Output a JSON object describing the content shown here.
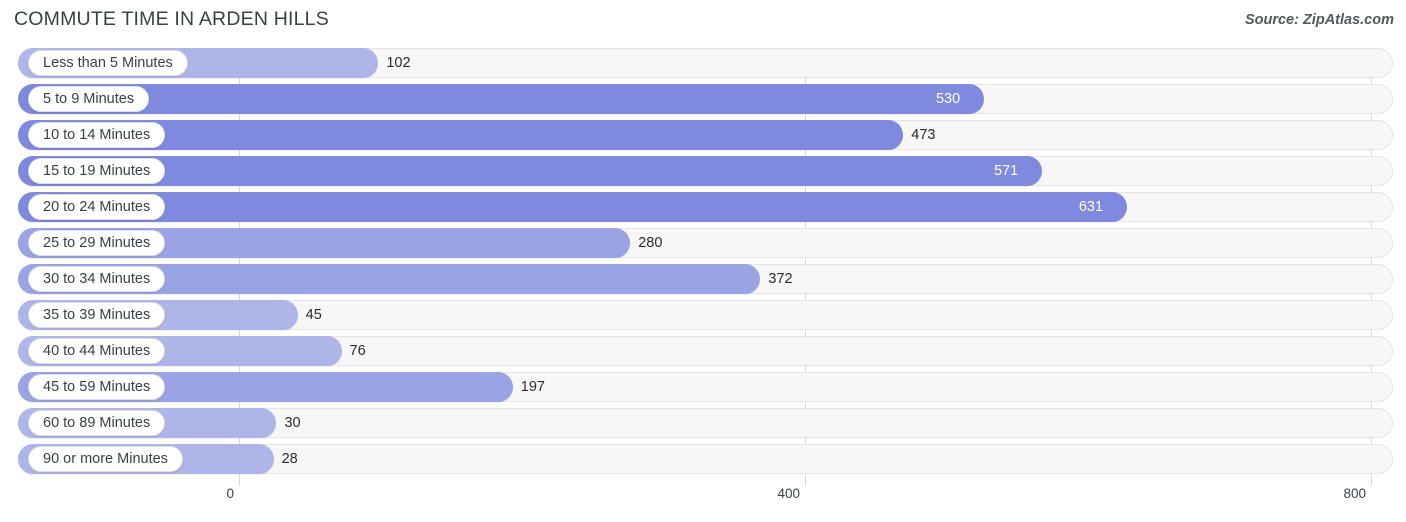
{
  "header": {
    "title": "COMMUTE TIME IN ARDEN HILLS",
    "source": "Source: ZipAtlas.com"
  },
  "colors": {
    "bar_strong": "#7f8ade",
    "bar_mid": "#9aa3e3",
    "bar_light": "#aeb5e8",
    "track": "#f7f7f7",
    "gridline": "#d9d9d9",
    "text": "#3c4043"
  },
  "axis": {
    "ticks": [
      "0",
      "400",
      "800"
    ],
    "tick_values": [
      0,
      400,
      800
    ],
    "min": 0,
    "max": 800
  },
  "chart_data": {
    "type": "bar",
    "orientation": "horizontal",
    "title": "COMMUTE TIME IN ARDEN HILLS",
    "source": "Source: ZipAtlas.com",
    "xlabel": "",
    "ylabel": "",
    "xlim": [
      0,
      800
    ],
    "grid": true,
    "legend": false,
    "categories": [
      "Less than 5 Minutes",
      "5 to 9 Minutes",
      "10 to 14 Minutes",
      "15 to 19 Minutes",
      "20 to 24 Minutes",
      "25 to 29 Minutes",
      "30 to 34 Minutes",
      "35 to 39 Minutes",
      "40 to 44 Minutes",
      "45 to 59 Minutes",
      "60 to 89 Minutes",
      "90 or more Minutes"
    ],
    "values": [
      102,
      530,
      473,
      571,
      631,
      280,
      372,
      45,
      76,
      197,
      30,
      28
    ],
    "value_labels": [
      "102",
      "530",
      "473",
      "571",
      "631",
      "280",
      "372",
      "45",
      "76",
      "197",
      "30",
      "28"
    ]
  },
  "rows": [
    {
      "label": "Less than 5 Minutes",
      "value": 102,
      "value_label": "102",
      "shade": "light",
      "inside": false
    },
    {
      "label": "5 to 9 Minutes",
      "value": 530,
      "value_label": "530",
      "shade": "strong",
      "inside": true
    },
    {
      "label": "10 to 14 Minutes",
      "value": 473,
      "value_label": "473",
      "shade": "strong",
      "inside": false
    },
    {
      "label": "15 to 19 Minutes",
      "value": 571,
      "value_label": "571",
      "shade": "strong",
      "inside": true
    },
    {
      "label": "20 to 24 Minutes",
      "value": 631,
      "value_label": "631",
      "shade": "strong",
      "inside": true
    },
    {
      "label": "25 to 29 Minutes",
      "value": 280,
      "value_label": "280",
      "shade": "mid",
      "inside": false
    },
    {
      "label": "30 to 34 Minutes",
      "value": 372,
      "value_label": "372",
      "shade": "mid",
      "inside": false
    },
    {
      "label": "35 to 39 Minutes",
      "value": 45,
      "value_label": "45",
      "shade": "light",
      "inside": false
    },
    {
      "label": "40 to 44 Minutes",
      "value": 76,
      "value_label": "76",
      "shade": "light",
      "inside": false
    },
    {
      "label": "45 to 59 Minutes",
      "value": 197,
      "value_label": "197",
      "shade": "mid",
      "inside": false
    },
    {
      "label": "60 to 89 Minutes",
      "value": 30,
      "value_label": "30",
      "shade": "light",
      "inside": false
    },
    {
      "label": "90 or more Minutes",
      "value": 28,
      "value_label": "28",
      "shade": "light",
      "inside": false
    }
  ]
}
